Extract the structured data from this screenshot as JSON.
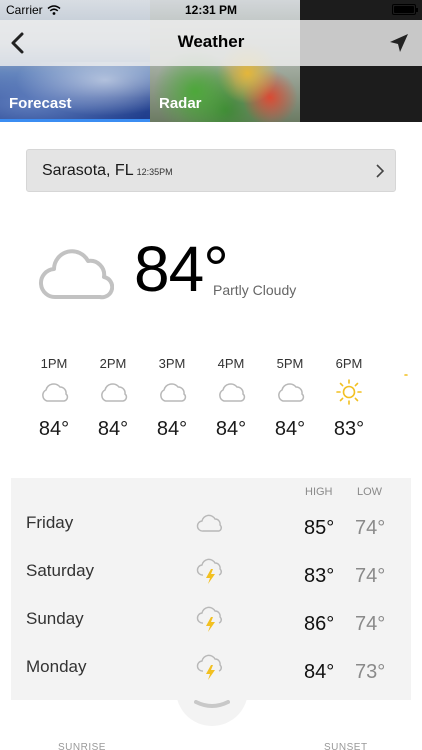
{
  "status_bar": {
    "carrier": "Carrier",
    "time": "12:31 PM"
  },
  "nav": {
    "title": "Weather",
    "back_icon": "chevron-left-icon",
    "location_icon": "location-arrow-icon"
  },
  "tabs": [
    {
      "label": "Forecast",
      "active": true
    },
    {
      "label": "Radar",
      "active": false
    }
  ],
  "location": {
    "city": "Sarasota, FL",
    "time": "12:35PM"
  },
  "current": {
    "temp": "84°",
    "condition": "Partly Cloudy",
    "icon": "cloud-icon"
  },
  "hourly": [
    {
      "time": "1PM",
      "icon": "cloud-icon",
      "temp": "84°"
    },
    {
      "time": "2PM",
      "icon": "cloud-icon",
      "temp": "84°"
    },
    {
      "time": "3PM",
      "icon": "cloud-icon",
      "temp": "84°"
    },
    {
      "time": "4PM",
      "icon": "cloud-icon",
      "temp": "84°"
    },
    {
      "time": "5PM",
      "icon": "cloud-icon",
      "temp": "84°"
    },
    {
      "time": "6PM",
      "icon": "sun-icon",
      "temp": "83°"
    }
  ],
  "daily_headers": {
    "high": "HIGH",
    "low": "LOW"
  },
  "daily": [
    {
      "day": "Friday",
      "icon": "cloud-icon",
      "high": "85°",
      "low": "74°"
    },
    {
      "day": "Saturday",
      "icon": "thunderstorm-icon",
      "high": "83°",
      "low": "74°"
    },
    {
      "day": "Sunday",
      "icon": "thunderstorm-icon",
      "high": "86°",
      "low": "74°"
    },
    {
      "day": "Monday",
      "icon": "thunderstorm-icon",
      "high": "84°",
      "low": "73°"
    }
  ],
  "footer": {
    "sunrise": "SUNRISE",
    "sunset": "SUNSET"
  },
  "colors": {
    "accent": "#3b8df2",
    "sun": "#f2c021",
    "bolt": "#f2c021",
    "cloud_stroke": "#b8b8b8"
  }
}
